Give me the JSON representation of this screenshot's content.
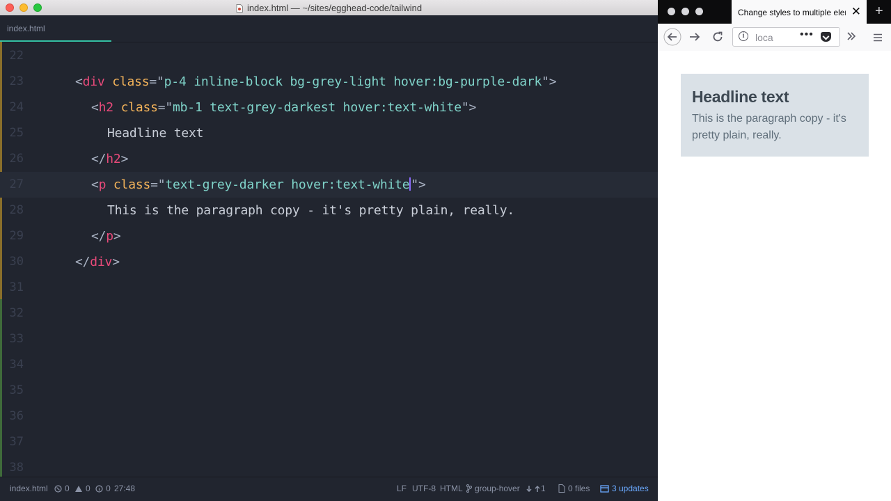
{
  "editor": {
    "window_title": "index.html — ~/sites/egghead-code/tailwind",
    "active_tab": "index.html",
    "lines": [
      {
        "n": "22",
        "parts": []
      },
      {
        "n": "23",
        "parts": [
          {
            "c": "pun",
            "t": "<"
          },
          {
            "c": "tag",
            "t": "div"
          },
          {
            "c": "pun",
            "t": " "
          },
          {
            "c": "attr",
            "t": "class"
          },
          {
            "c": "pun",
            "t": "=\""
          },
          {
            "c": "str",
            "t": "p-4 inline-block bg-grey-light hover:bg-purple-dark"
          },
          {
            "c": "pun",
            "t": "\">"
          }
        ]
      },
      {
        "n": "24",
        "parts": [
          {
            "c": "pun",
            "t": "<"
          },
          {
            "c": "tag",
            "t": "h2"
          },
          {
            "c": "pun",
            "t": " "
          },
          {
            "c": "attr",
            "t": "class"
          },
          {
            "c": "pun",
            "t": "=\""
          },
          {
            "c": "str",
            "t": "mb-1 text-grey-darkest hover:text-white"
          },
          {
            "c": "pun",
            "t": "\">"
          }
        ]
      },
      {
        "n": "25",
        "parts": [
          {
            "c": "txt",
            "t": "Headline text"
          }
        ]
      },
      {
        "n": "26",
        "parts": [
          {
            "c": "pun",
            "t": "</"
          },
          {
            "c": "tag",
            "t": "h2"
          },
          {
            "c": "pun",
            "t": ">"
          }
        ]
      },
      {
        "n": "27",
        "parts": [
          {
            "c": "pun",
            "t": "<"
          },
          {
            "c": "tag",
            "t": "p"
          },
          {
            "c": "pun",
            "t": " "
          },
          {
            "c": "attr",
            "t": "class"
          },
          {
            "c": "pun",
            "t": "=\""
          },
          {
            "c": "str",
            "t": "text-grey-darker hover:text-white"
          },
          {
            "c": "caret",
            "t": ""
          },
          {
            "c": "pun",
            "t": "\">"
          }
        ]
      },
      {
        "n": "28",
        "parts": [
          {
            "c": "txt",
            "t": "This is the paragraph copy - it's pretty plain, really."
          }
        ]
      },
      {
        "n": "29",
        "parts": [
          {
            "c": "pun",
            "t": "</"
          },
          {
            "c": "tag",
            "t": "p"
          },
          {
            "c": "pun",
            "t": ">"
          }
        ]
      },
      {
        "n": "30",
        "parts": [
          {
            "c": "pun",
            "t": "</"
          },
          {
            "c": "tag",
            "t": "div"
          },
          {
            "c": "pun",
            "t": ">"
          }
        ]
      },
      {
        "n": "31",
        "parts": []
      },
      {
        "n": "32",
        "parts": []
      },
      {
        "n": "33",
        "parts": []
      },
      {
        "n": "34",
        "parts": []
      },
      {
        "n": "35",
        "parts": []
      },
      {
        "n": "36",
        "parts": []
      },
      {
        "n": "37",
        "parts": []
      },
      {
        "n": "38",
        "parts": []
      }
    ],
    "status": {
      "file": "index.html",
      "errors": "0",
      "warnings": "0",
      "infos": "0",
      "cursor_position": "27:48",
      "line_ending": "LF",
      "encoding": "UTF-8",
      "grammar": "HTML",
      "branch": "group-hover",
      "commits_behind": "1",
      "files_changed": "0 files",
      "updates": "3 updates"
    }
  },
  "browser": {
    "tab_title": "Change styles to multiple elem",
    "url_text": "loca",
    "card": {
      "headline": "Headline text",
      "paragraph": "This is the paragraph copy - it's pretty plain, really."
    }
  },
  "colors": {
    "editor_bg": "#21252f",
    "tag": "#e94a7a",
    "attr": "#f3b35a",
    "string": "#7fd3c9",
    "tab_accent": "#35c0a4",
    "card_bg": "#dae1e7",
    "status_accent": "#6aa9ff"
  }
}
